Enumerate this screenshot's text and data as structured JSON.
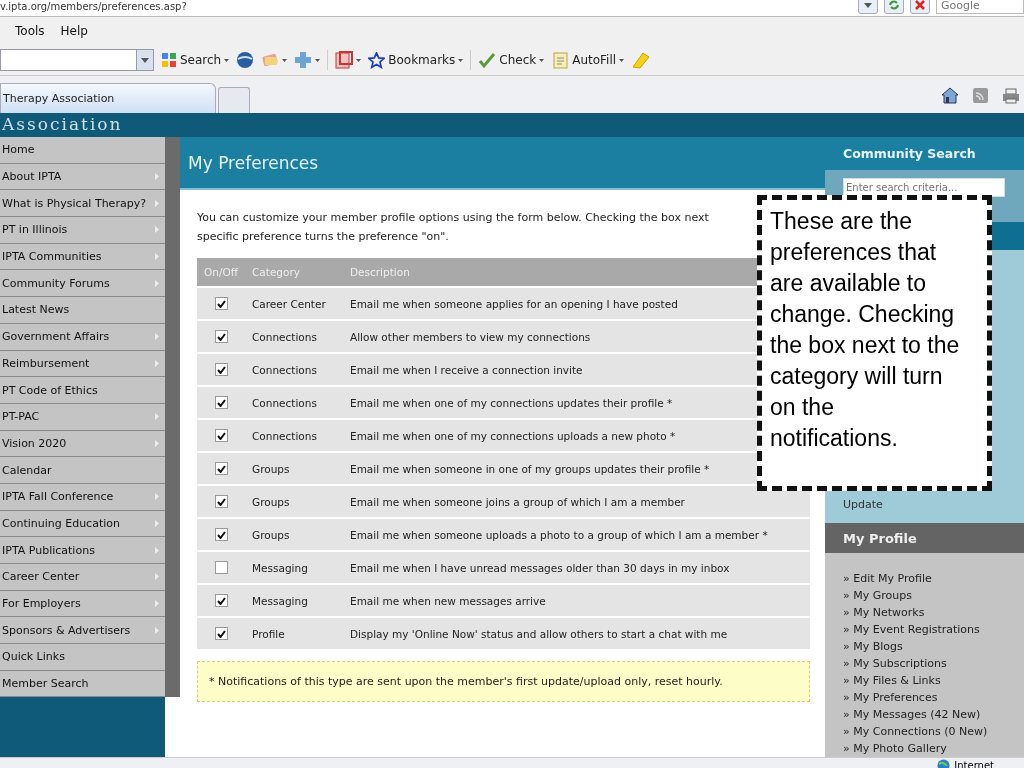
{
  "browser": {
    "address": "v.ipta.org/members/preferences.asp?",
    "search_placeholder": "Google",
    "menu": [
      "Tools",
      "Help"
    ],
    "toolbar": [
      {
        "kind": "search",
        "label": "Search"
      },
      {
        "kind": "globe"
      },
      {
        "kind": "card"
      },
      {
        "kind": "plus"
      },
      {
        "kind": "pdf"
      },
      {
        "kind": "bookmarks",
        "label": "Bookmarks"
      },
      {
        "kind": "check",
        "label": "Check"
      },
      {
        "kind": "autofill",
        "label": "AutoFill"
      },
      {
        "kind": "highlighter"
      }
    ],
    "tabs": [
      {
        "label": "Therapy Association",
        "selected": true
      }
    ]
  },
  "site": {
    "header_text": "Association",
    "nav": [
      {
        "label": "Home",
        "submenu": false
      },
      {
        "label": "About IPTA",
        "submenu": true
      },
      {
        "label": "What is Physical Therapy?",
        "submenu": true
      },
      {
        "label": "PT in Illinois",
        "submenu": true
      },
      {
        "label": "IPTA Communities",
        "submenu": true
      },
      {
        "label": "Community Forums",
        "submenu": true
      },
      {
        "label": "Latest News",
        "submenu": false
      },
      {
        "label": "Government Affairs",
        "submenu": true
      },
      {
        "label": "Reimbursement",
        "submenu": true
      },
      {
        "label": "PT Code of Ethics",
        "submenu": false
      },
      {
        "label": "PT-PAC",
        "submenu": true
      },
      {
        "label": "Vision 2020",
        "submenu": true
      },
      {
        "label": "Calendar",
        "submenu": false
      },
      {
        "label": "IPTA Fall Conference",
        "submenu": true
      },
      {
        "label": "Continuing Education",
        "submenu": true
      },
      {
        "label": "IPTA Publications",
        "submenu": true
      },
      {
        "label": "Career Center",
        "submenu": true
      },
      {
        "label": "For Employers",
        "submenu": true
      },
      {
        "label": "Sponsors & Advertisers",
        "submenu": true
      },
      {
        "label": "Quick Links",
        "submenu": false
      },
      {
        "label": "Member Search",
        "submenu": false
      }
    ],
    "page_title": "My Preferences",
    "intro": "You can customize your member profile options using the form below. Checking the box next\nspecific preference turns the preference \"on\".",
    "table": {
      "columns": [
        "On/Off",
        "Category",
        "Description"
      ],
      "rows": [
        {
          "checked": true,
          "category": "Career Center",
          "description": "Email me when someone applies for an opening I have posted"
        },
        {
          "checked": true,
          "category": "Connections",
          "description": "Allow other members to view my connections"
        },
        {
          "checked": true,
          "category": "Connections",
          "description": "Email me when I receive a connection invite"
        },
        {
          "checked": true,
          "category": "Connections",
          "description": "Email me when one of my connections updates their profile *"
        },
        {
          "checked": true,
          "category": "Connections",
          "description": "Email me when one of my connections uploads a new photo *"
        },
        {
          "checked": true,
          "category": "Groups",
          "description": "Email me when someone in one of my groups updates their profile *"
        },
        {
          "checked": true,
          "category": "Groups",
          "description": "Email me when someone joins a group of which I am a member"
        },
        {
          "checked": true,
          "category": "Groups",
          "description": "Email me when someone uploads a photo to a group of which I am a member *"
        },
        {
          "checked": false,
          "category": "Messaging",
          "description": "Email me when I have unread messages older than 30 days in my inbox"
        },
        {
          "checked": true,
          "category": "Messaging",
          "description": "Email me when new messages arrive"
        },
        {
          "checked": true,
          "category": "Profile",
          "description": "Display my 'Online Now' status and allow others to start a chat with me"
        }
      ]
    },
    "note": "* Notifications of this type are sent upon the member's first update/upload only, reset hourly.",
    "sidebar": {
      "search_title": "Community Search",
      "search_placeholder": "Enter search criteria...",
      "update_text": "Update",
      "profile_title": "My Profile",
      "profile_links": [
        "» Edit My Profile",
        "» My Groups",
        "» My Networks",
        "» My Event Registrations",
        "» My Blogs",
        "» My Subscriptions",
        "» My Files & Links",
        "» My Preferences",
        "» My Messages (42 New)",
        "» My Connections (0 New)",
        "» My Photo Gallery"
      ]
    }
  },
  "callout": {
    "text": "These are the preferences that are available to change. Checking the box next to the category will turn on the notifications."
  },
  "status_bar": {
    "zone": "Internet"
  }
}
